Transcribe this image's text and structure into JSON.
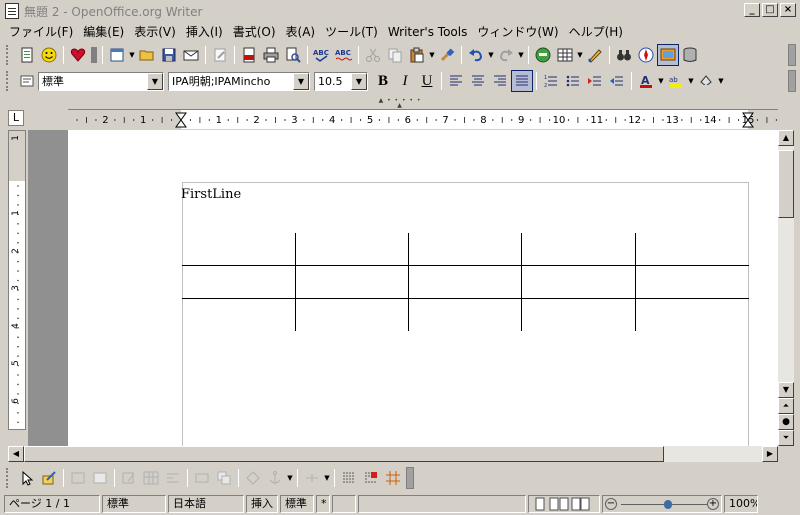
{
  "window": {
    "title": "無題 2 - OpenOffice.org Writer",
    "controls": [
      "_",
      "□",
      "×"
    ]
  },
  "menu": [
    "ファイル(F)",
    "編集(E)",
    "表示(V)",
    "挿入(I)",
    "書式(O)",
    "表(A)",
    "ツール(T)",
    "Writer's Tools",
    "ウィンドウ(W)",
    "ヘルプ(H)"
  ],
  "format": {
    "style": "標準",
    "font": "IPA明朝;IPAMincho",
    "size": "10.5"
  },
  "ruler_h": {
    "numbers": [
      "2",
      "1",
      "1",
      "2",
      "3",
      "4",
      "5",
      "6",
      "7",
      "8",
      "9",
      "10",
      "11",
      "12",
      "13",
      "14",
      "15"
    ]
  },
  "ruler_v": {
    "numbers": [
      "1",
      "1",
      "2",
      "3",
      "4",
      "5",
      "6"
    ]
  },
  "document": {
    "text": "FirstLine"
  },
  "status": {
    "page": "ページ 1 / 1",
    "page_style": "標準",
    "language": "日本語",
    "insert_mode": "挿入",
    "selection_mode": "標準",
    "modified": "*",
    "zoom": "100%",
    "zoom_level": 0.55
  },
  "icons": {
    "tb1": [
      "new-document-icon",
      "smiley-icon",
      "heart-icon",
      "templates-icon",
      "open-icon",
      "save-icon",
      "email-icon",
      "edit-file-icon",
      "export-pdf-icon",
      "print-icon",
      "print-preview-icon",
      "spellcheck-icon",
      "autospellcheck-icon",
      "cut-icon",
      "copy-icon",
      "paste-icon",
      "clone-format-icon",
      "undo-icon",
      "redo-icon",
      "navigator-icon",
      "table-icon",
      "draw-icon",
      "find-icon",
      "navigator-compass-icon",
      "gallery-icon",
      "database-icon"
    ]
  }
}
